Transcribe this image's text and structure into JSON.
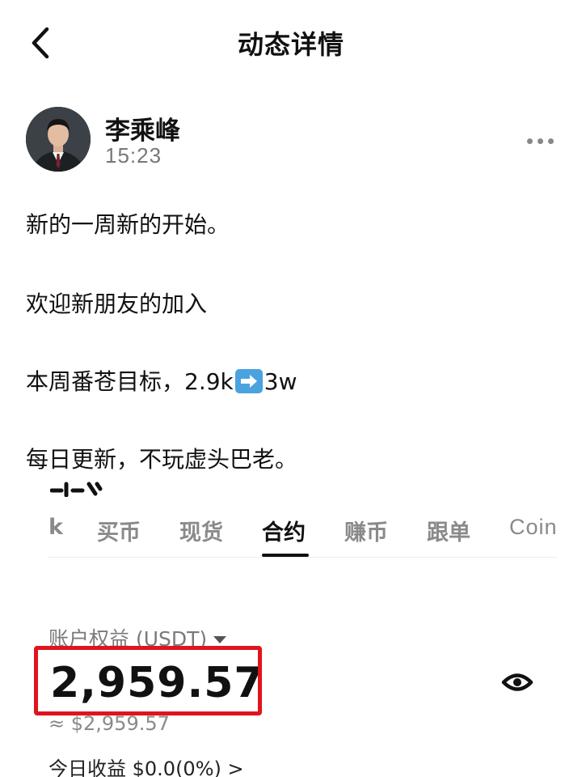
{
  "nav": {
    "title": "动态详情",
    "back_icon": "chevron-left-icon"
  },
  "post": {
    "author": "李乘峰",
    "time": "15:23",
    "lines": {
      "l1": "新的一周新的开始。",
      "l2": "欢迎新朋友的加入",
      "l3_prefix": "本周番苍目标，2.9k",
      "l3_suffix": "3w",
      "l4": "每日更新，不玩虚头巴老。"
    },
    "emoji": "arrow-right-emoji-icon"
  },
  "screenshot": {
    "tab_fragment": "k",
    "tabs": [
      "买币",
      "现货",
      "合约",
      "赚币",
      "跟单",
      "Coin"
    ],
    "active_tab": "合约",
    "equity_label": "账户权益 (USDT)",
    "equity_value": "2,959.57",
    "approx": "≈ $2,959.57",
    "today_pnl": "今日收益 $0.0(0%) >",
    "highlight_color": "#e0141e"
  }
}
